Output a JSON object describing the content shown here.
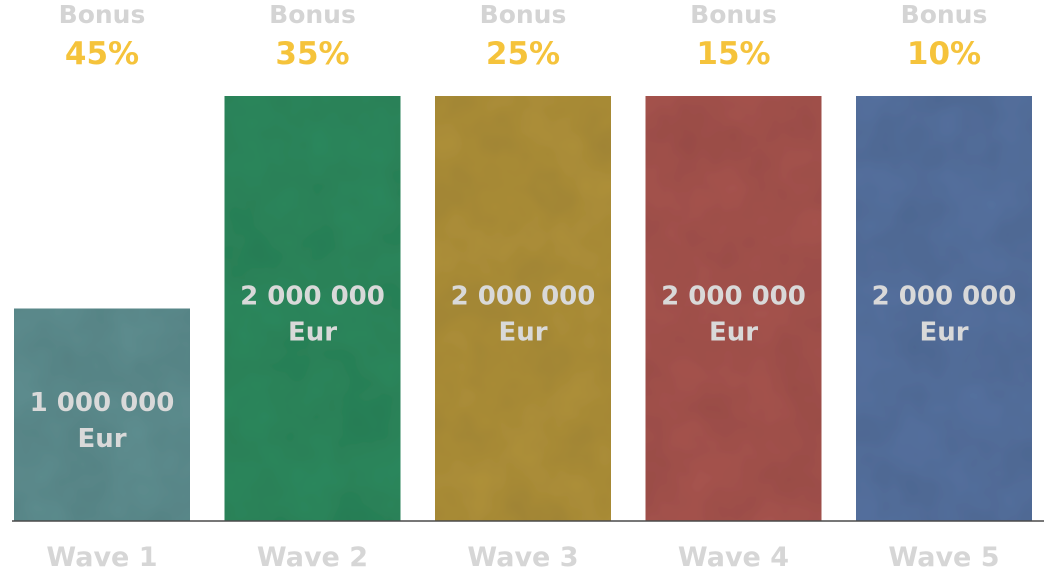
{
  "chart_data": {
    "type": "bar",
    "categories": [
      "Wave 1",
      "Wave 2",
      "Wave 3",
      "Wave 4",
      "Wave 5"
    ],
    "values": [
      1000000,
      2000000,
      2000000,
      2000000,
      2000000
    ],
    "value_labels": [
      [
        "1 000 000",
        "Eur"
      ],
      [
        "2 000 000",
        "Eur"
      ],
      [
        "2 000 000",
        "Eur"
      ],
      [
        "2 000 000",
        "Eur"
      ],
      [
        "2 000 000",
        "Eur"
      ]
    ],
    "bonus_word": "Bonus",
    "bonuses": [
      "45%",
      "35%",
      "25%",
      "15%",
      "10%"
    ],
    "colors": [
      "#5f8f91",
      "#2f8a5e",
      "#b0923a",
      "#a8554f",
      "#5672a0"
    ],
    "ylim": [
      0,
      2000000
    ],
    "grid": false,
    "title": "",
    "xlabel": "",
    "ylabel": ""
  }
}
